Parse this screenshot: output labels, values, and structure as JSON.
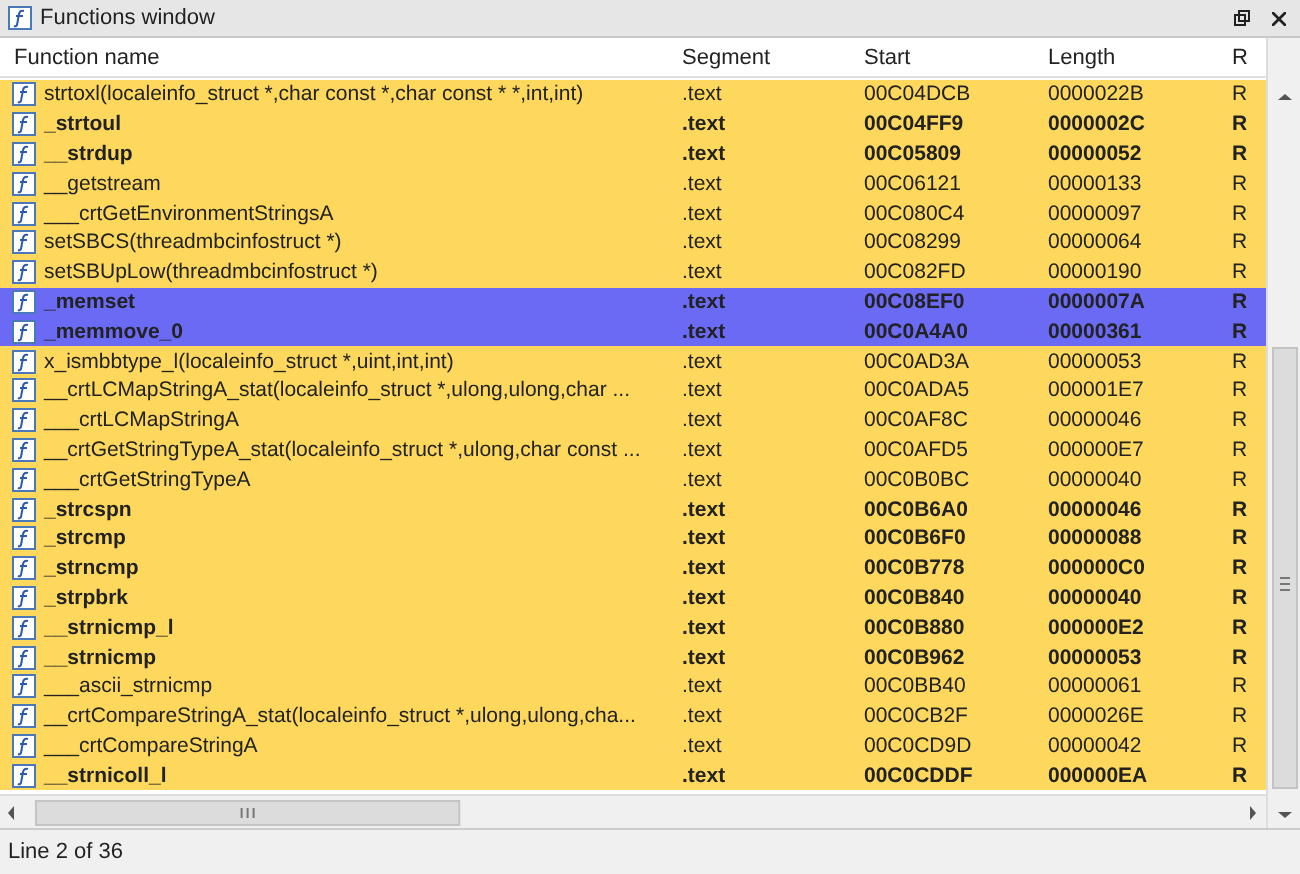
{
  "window": {
    "title": "Functions window"
  },
  "table": {
    "columns": [
      "Function name",
      "Segment",
      "Start",
      "Length",
      "R"
    ],
    "rows": [
      {
        "name": "strtoxl(localeinfo_struct *,char const *,char const * *,int,int)",
        "segment": ".text",
        "start": "00C04DCB",
        "length": "0000022B",
        "r": "R",
        "bold": false,
        "selected": false
      },
      {
        "name": "_strtoul",
        "segment": ".text",
        "start": "00C04FF9",
        "length": "0000002C",
        "r": "R",
        "bold": true,
        "selected": false
      },
      {
        "name": "__strdup",
        "segment": ".text",
        "start": "00C05809",
        "length": "00000052",
        "r": "R",
        "bold": true,
        "selected": false
      },
      {
        "name": "__getstream",
        "segment": ".text",
        "start": "00C06121",
        "length": "00000133",
        "r": "R",
        "bold": false,
        "selected": false
      },
      {
        "name": "___crtGetEnvironmentStringsA",
        "segment": ".text",
        "start": "00C080C4",
        "length": "00000097",
        "r": "R",
        "bold": false,
        "selected": false
      },
      {
        "name": "setSBCS(threadmbcinfostruct *)",
        "segment": ".text",
        "start": "00C08299",
        "length": "00000064",
        "r": "R",
        "bold": false,
        "selected": false
      },
      {
        "name": "setSBUpLow(threadmbcinfostruct *)",
        "segment": ".text",
        "start": "00C082FD",
        "length": "00000190",
        "r": "R",
        "bold": false,
        "selected": false
      },
      {
        "name": "_memset",
        "segment": ".text",
        "start": "00C08EF0",
        "length": "0000007A",
        "r": "R",
        "bold": true,
        "selected": true
      },
      {
        "name": "_memmove_0",
        "segment": ".text",
        "start": "00C0A4A0",
        "length": "00000361",
        "r": "R",
        "bold": true,
        "selected": true
      },
      {
        "name": "x_ismbbtype_l(localeinfo_struct *,uint,int,int)",
        "segment": ".text",
        "start": "00C0AD3A",
        "length": "00000053",
        "r": "R",
        "bold": false,
        "selected": false
      },
      {
        "name": "__crtLCMapStringA_stat(localeinfo_struct *,ulong,ulong,char ...",
        "segment": ".text",
        "start": "00C0ADA5",
        "length": "000001E7",
        "r": "R",
        "bold": false,
        "selected": false
      },
      {
        "name": "___crtLCMapStringA",
        "segment": ".text",
        "start": "00C0AF8C",
        "length": "00000046",
        "r": "R",
        "bold": false,
        "selected": false
      },
      {
        "name": "__crtGetStringTypeA_stat(localeinfo_struct *,ulong,char const ...",
        "segment": ".text",
        "start": "00C0AFD5",
        "length": "000000E7",
        "r": "R",
        "bold": false,
        "selected": false
      },
      {
        "name": "___crtGetStringTypeA",
        "segment": ".text",
        "start": "00C0B0BC",
        "length": "00000040",
        "r": "R",
        "bold": false,
        "selected": false
      },
      {
        "name": "_strcspn",
        "segment": ".text",
        "start": "00C0B6A0",
        "length": "00000046",
        "r": "R",
        "bold": true,
        "selected": false
      },
      {
        "name": "_strcmp",
        "segment": ".text",
        "start": "00C0B6F0",
        "length": "00000088",
        "r": "R",
        "bold": true,
        "selected": false
      },
      {
        "name": "_strncmp",
        "segment": ".text",
        "start": "00C0B778",
        "length": "000000C0",
        "r": "R",
        "bold": true,
        "selected": false
      },
      {
        "name": "_strpbrk",
        "segment": ".text",
        "start": "00C0B840",
        "length": "00000040",
        "r": "R",
        "bold": true,
        "selected": false
      },
      {
        "name": "__strnicmp_l",
        "segment": ".text",
        "start": "00C0B880",
        "length": "000000E2",
        "r": "R",
        "bold": true,
        "selected": false
      },
      {
        "name": "__strnicmp",
        "segment": ".text",
        "start": "00C0B962",
        "length": "00000053",
        "r": "R",
        "bold": true,
        "selected": false
      },
      {
        "name": "___ascii_strnicmp",
        "segment": ".text",
        "start": "00C0BB40",
        "length": "00000061",
        "r": "R",
        "bold": false,
        "selected": false
      },
      {
        "name": "__crtCompareStringA_stat(localeinfo_struct *,ulong,ulong,cha...",
        "segment": ".text",
        "start": "00C0CB2F",
        "length": "0000026E",
        "r": "R",
        "bold": false,
        "selected": false
      },
      {
        "name": "___crtCompareStringA",
        "segment": ".text",
        "start": "00C0CD9D",
        "length": "00000042",
        "r": "R",
        "bold": false,
        "selected": false
      },
      {
        "name": "__strnicoll_l",
        "segment": ".text",
        "start": "00C0CDDF",
        "length": "000000EA",
        "r": "R",
        "bold": true,
        "selected": false
      }
    ]
  },
  "status_bar": "Line 2 of 36"
}
